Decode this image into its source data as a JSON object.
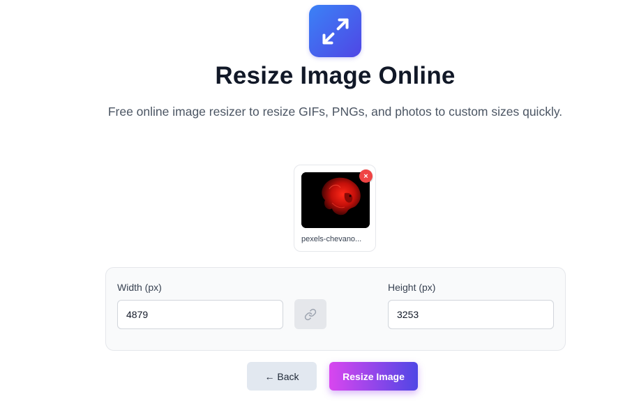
{
  "header": {
    "logo_icon": "expand-arrows-icon",
    "title": "Resize Image Online",
    "subtitle": "Free online image resizer to resize GIFs, PNGs, and photos to custom sizes quickly."
  },
  "file": {
    "name": "pexels-chevano...",
    "remove_label": "×"
  },
  "dimensions": {
    "width_label": "Width (px)",
    "width_value": "4879",
    "height_label": "Height (px)",
    "height_value": "3253",
    "link_icon": "link-icon"
  },
  "actions": {
    "back_label": "← Back",
    "resize_label": "Resize Image"
  },
  "colors": {
    "logo_gradient_start": "#3b82f6",
    "logo_gradient_end": "#4f46e5",
    "remove_red": "#ef4444",
    "resize_gradient_start": "#d946ef",
    "resize_gradient_end": "#4f46e5"
  }
}
